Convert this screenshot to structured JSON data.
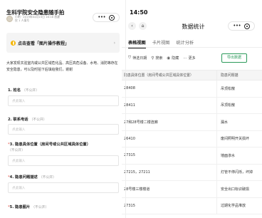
{
  "left": {
    "title": "生科学院安全隐患随手拍",
    "meta_line1": "小明 · 2019年04月15日 16:16 创建",
    "meta_line2": "仅 1 人填写",
    "banner_text": "点击查看「图片操作教程」",
    "banner_chevron": "›",
    "intro": "大家发现实验室内或公共区域危化品、高压高危设备、水电、消防等存在安全隐患，可以及时拍下后填给我们，谢谢",
    "fields": [
      {
        "num": "1.",
        "label": "姓名",
        "required": false,
        "optional_note": "（不公开）",
        "placeholder": "点此输入"
      },
      {
        "num": "2.",
        "label": "联系电话",
        "required": false,
        "optional_note": "（不公开）",
        "placeholder": "点此输入"
      },
      {
        "num": "3.",
        "label": "隐患具体位置（房间号或公共区域具体位置）",
        "required": true,
        "optional_note": "（不公开）",
        "placeholder": "点此输入"
      },
      {
        "num": "4.",
        "label": "隐患问题描述",
        "required": true,
        "optional_note": "（不公开）",
        "placeholder": "点此输入"
      },
      {
        "num": "5.",
        "label": "隐患图片",
        "required": true,
        "optional_note": "（不公开）",
        "placeholder": ""
      }
    ]
  },
  "right": {
    "status_time": "14:50",
    "nav_title": "数据统计",
    "back_icon": "‹",
    "home_icon": "⌂",
    "tabs": [
      "表格视图",
      "卡片视图",
      "统计分析"
    ],
    "active_tab": "表格视图",
    "toolbar": {
      "filter": "筛选日期",
      "search": "搜索",
      "hide": "隐藏",
      "more": "更多",
      "export": "导出数据"
    },
    "table": {
      "headers": [
        "隐患具体位置（房间号或公共区域具体位置）",
        "隐患问题描"
      ],
      "rows": [
        [
          "28408",
          "吊顶松散"
        ],
        [
          "28411",
          "吊顶松散"
        ],
        [
          "27和28号楼二楼连廊",
          "漏水"
        ],
        [
          "26410",
          "废间照明开关损坏"
        ],
        [
          "27315",
          "墙面渗水"
        ],
        [
          "27215，27211",
          "灯管不停闪烁，坏掉"
        ],
        [
          "28号楼三楼楼道",
          "安全出口标识破损"
        ],
        [
          "27315",
          "过期化学品堆放"
        ]
      ]
    }
  },
  "colors": {
    "accent_green": "#2b9a5a",
    "required_red": "#e54d42",
    "banner_icon": "#f4b400"
  }
}
